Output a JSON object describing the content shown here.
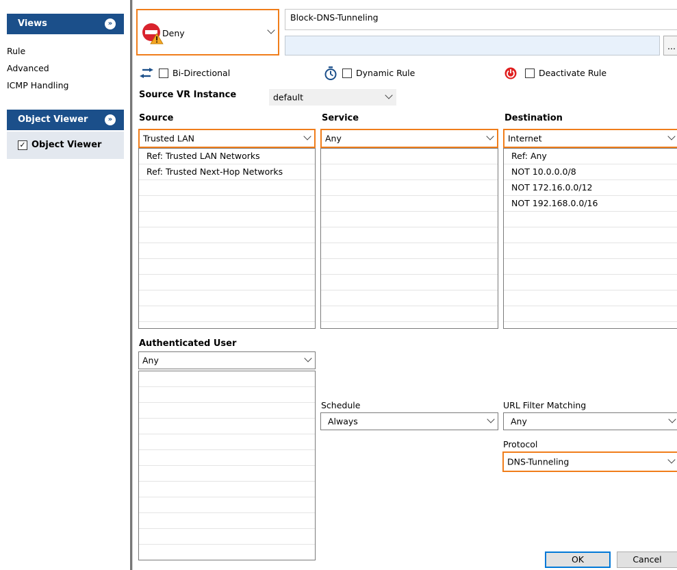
{
  "views": {
    "title": "Views",
    "items": [
      "Rule",
      "Advanced",
      "ICMP Handling"
    ]
  },
  "object_viewer": {
    "title": "Object Viewer",
    "checkbox_label": "Object Viewer",
    "checked_glyph": "✓"
  },
  "rule": {
    "action": "Deny",
    "name": "Block-DNS-Tunneling",
    "description": "",
    "browse_label": "..."
  },
  "options": {
    "bidirectional": "Bi-Directional",
    "dynamic": "Dynamic Rule",
    "deactivate": "Deactivate Rule"
  },
  "vr_instance": {
    "label": "Source VR Instance",
    "value": "default"
  },
  "source": {
    "label": "Source",
    "value": "Trusted  LAN",
    "items": [
      "Ref: Trusted LAN Networks",
      "Ref: Trusted Next-Hop Networks",
      "",
      "",
      "",
      "",
      "",
      "",
      "",
      "",
      ""
    ]
  },
  "service": {
    "label": "Service",
    "value": "Any",
    "items": [
      "",
      "",
      "",
      "",
      "",
      "",
      "",
      "",
      "",
      "",
      ""
    ]
  },
  "destination": {
    "label": "Destination",
    "value": "Internet",
    "items": [
      "Ref: Any",
      "NOT 10.0.0.0/8",
      "NOT 172.16.0.0/12",
      "NOT 192.168.0.0/16",
      "",
      "",
      "",
      "",
      "",
      "",
      ""
    ]
  },
  "auth_user": {
    "label": "Authenticated User",
    "value": "Any",
    "items": [
      "",
      "",
      "",
      "",
      "",
      "",
      "",
      "",
      "",
      "",
      "",
      "",
      ""
    ]
  },
  "schedule": {
    "label": "Schedule",
    "value": "Always"
  },
  "url_filter": {
    "label": "URL Filter Matching",
    "value": "Any"
  },
  "protocol": {
    "label": "Protocol",
    "value": "DNS-Tunneling"
  },
  "buttons": {
    "ok": "OK",
    "cancel": "Cancel"
  },
  "colors": {
    "highlight": "#f07d1a",
    "header": "#1b4f8a",
    "deny": "#d9232d",
    "warn": "#f5a623",
    "power": "#e02020",
    "arrows": "#1b4f8a"
  }
}
